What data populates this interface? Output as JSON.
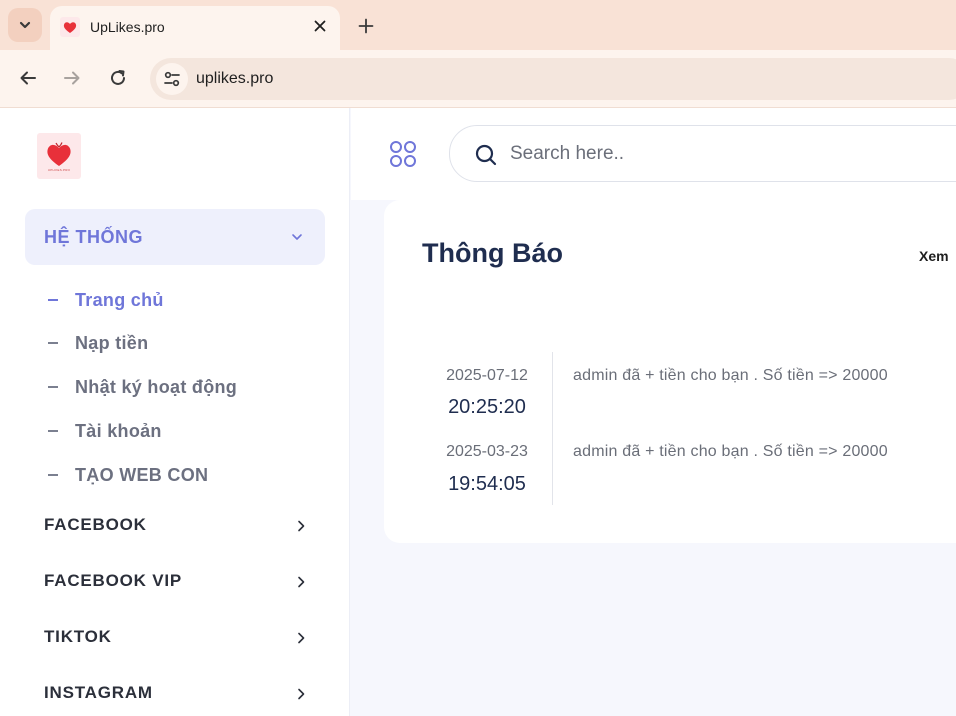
{
  "browser": {
    "tab_title": "UpLikes.pro",
    "url": "uplikes.pro"
  },
  "sidebar": {
    "logo_caption": "UPLIKES.PRO",
    "section_title": "HỆ THỐNG",
    "sub_items": [
      {
        "label": "Trang chủ",
        "active": true
      },
      {
        "label": "Nạp tiền",
        "active": false
      },
      {
        "label": "Nhật ký hoạt động",
        "active": false
      },
      {
        "label": "Tài khoản",
        "active": false
      },
      {
        "label": "TẠO WEB CON",
        "active": false
      }
    ],
    "categories": [
      {
        "label": "FACEBOOK"
      },
      {
        "label": "FACEBOOK VIP"
      },
      {
        "label": "TIKTOK"
      },
      {
        "label": "INSTAGRAM"
      }
    ]
  },
  "header": {
    "search_placeholder": "Search here.."
  },
  "notice": {
    "title": "Thông Báo",
    "view_all": "Xem",
    "rows": [
      {
        "date": "2025-07-12",
        "time": "20:25:20",
        "message": "admin đã + tiền cho bạn . Số tiền => 20000"
      },
      {
        "date": "2025-03-23",
        "time": "19:54:05",
        "message": "admin đã + tiền cho bạn . Số tiền => 20000"
      }
    ]
  },
  "colors": {
    "accent": "#6f76d9",
    "title": "#1f2d4f",
    "tab_strip": "#f9e2d6"
  }
}
